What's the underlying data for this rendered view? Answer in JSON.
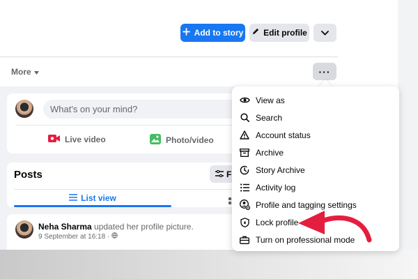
{
  "header": {
    "add_story_label": "Add to story",
    "edit_profile_label": "Edit profile"
  },
  "tabs": {
    "more_label": "More"
  },
  "composer": {
    "placeholder": "What's on your mind?",
    "live_video_label": "Live video",
    "photo_video_label": "Photo/video"
  },
  "posts": {
    "title": "Posts",
    "filters_label": "Fi",
    "list_view_label": "List view"
  },
  "post": {
    "author": "Neha Sharma",
    "action": " updated her profile picture.",
    "timestamp": "9 September at 16:18 ·"
  },
  "menu": {
    "items": [
      {
        "label": "View as",
        "icon": "eye-icon"
      },
      {
        "label": "Search",
        "icon": "search-icon"
      },
      {
        "label": "Account status",
        "icon": "warning-icon"
      },
      {
        "label": "Archive",
        "icon": "archive-icon"
      },
      {
        "label": "Story Archive",
        "icon": "clock-icon"
      },
      {
        "label": "Activity log",
        "icon": "list-icon"
      },
      {
        "label": "Profile and tagging settings",
        "icon": "profile-settings-icon"
      },
      {
        "label": "Lock profile",
        "icon": "shield-lock-icon"
      },
      {
        "label": "Turn on professional mode",
        "icon": "briefcase-icon"
      }
    ]
  },
  "colors": {
    "accent": "#1877f2",
    "annotation_arrow": "#e41e3f"
  }
}
